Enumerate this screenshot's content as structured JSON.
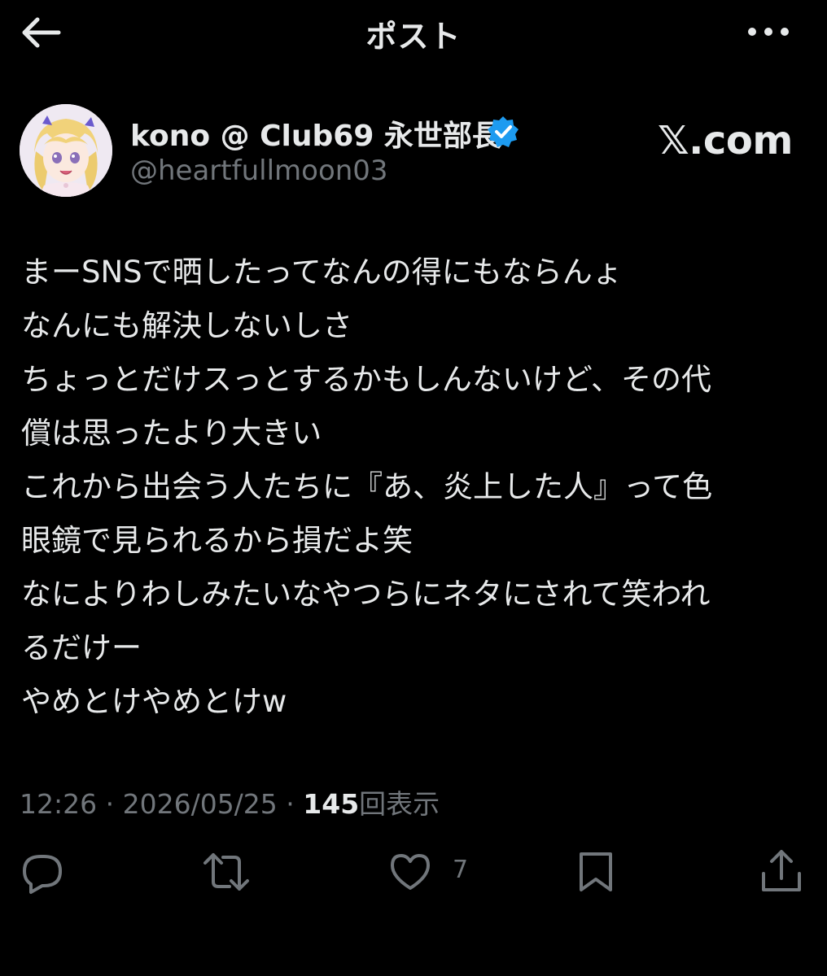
{
  "header": {
    "title": "ポスト",
    "back_icon": "arrow-left-icon",
    "more_icon": "more-horizontal-icon"
  },
  "author": {
    "display_name": "kono @ Club69 永世部長",
    "handle": "@heartfullmoon03",
    "verified": true,
    "verified_color": "#1d9bf0"
  },
  "watermark": "𝕏.com",
  "post": {
    "lines": [
      "まーSNSで晒したってなんの得にもならんょ",
      "なんにも解決しないしさ",
      "ちょっとだけスっとするかもしんないけど、その代",
      "償は思ったより大きい",
      "これから出会う人たちに『あ、炎上した人』って色",
      "眼鏡で見られるから損だよ笑",
      "なによりわしみたいなやつらにネタにされて笑われ",
      "るだけー",
      "やめとけやめとけw"
    ]
  },
  "meta": {
    "time": "12:26",
    "separator": " · ",
    "date": "2026/05/25",
    "views_count": "145",
    "views_label": "回表示"
  },
  "actions": {
    "reply_icon": "reply-icon",
    "repost_icon": "repost-icon",
    "like_icon": "heart-icon",
    "like_count": "7",
    "bookmark_icon": "bookmark-icon",
    "share_icon": "share-icon"
  },
  "colors": {
    "background": "#000000",
    "text": "#e7e9ea",
    "secondary": "#71767b",
    "accent": "#1d9bf0"
  }
}
